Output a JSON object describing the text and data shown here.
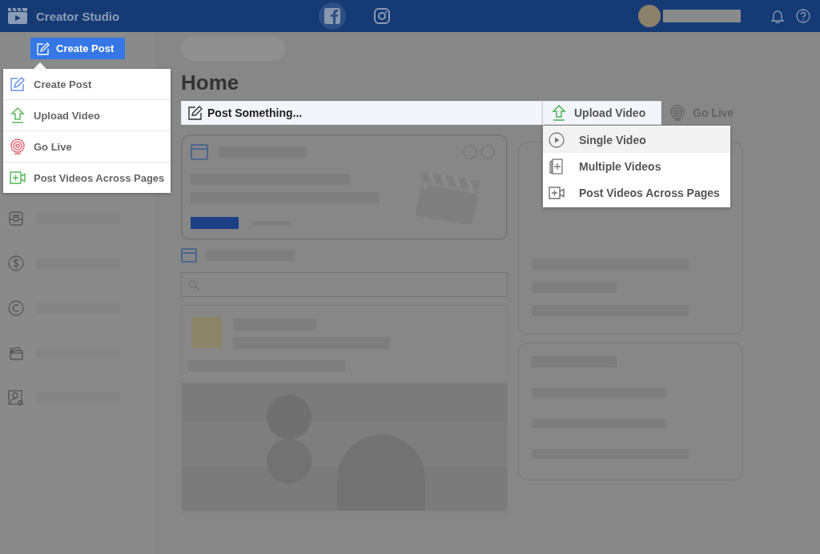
{
  "header": {
    "title": "Creator Studio",
    "platforms": [
      {
        "kind": "facebook",
        "selected": true
      },
      {
        "kind": "instagram",
        "selected": false
      }
    ]
  },
  "sidebar": {
    "create_button": "Create Post",
    "items": [
      {
        "kind": "inbox"
      },
      {
        "kind": "money"
      },
      {
        "kind": "rights"
      },
      {
        "kind": "library"
      },
      {
        "kind": "roles"
      }
    ]
  },
  "create_menu": {
    "items": [
      {
        "kind": "post",
        "label": "Create Post"
      },
      {
        "kind": "upload",
        "label": "Upload Video"
      },
      {
        "kind": "live",
        "label": "Go Live"
      },
      {
        "kind": "cross-post",
        "label": "Post Videos Across Pages"
      }
    ]
  },
  "page": {
    "title": "Home"
  },
  "composer": {
    "prompt": "Post Something...",
    "actions": [
      {
        "kind": "upload",
        "label": "Upload Video",
        "selected": true
      },
      {
        "kind": "live",
        "label": "Go Live",
        "selected": false
      }
    ]
  },
  "upload_menu": {
    "items": [
      {
        "kind": "single",
        "label": "Single Video",
        "selected": true
      },
      {
        "kind": "multiple",
        "label": "Multiple Videos",
        "selected": false
      },
      {
        "kind": "cross-post",
        "label": "Post Videos Across Pages",
        "selected": false
      }
    ]
  }
}
